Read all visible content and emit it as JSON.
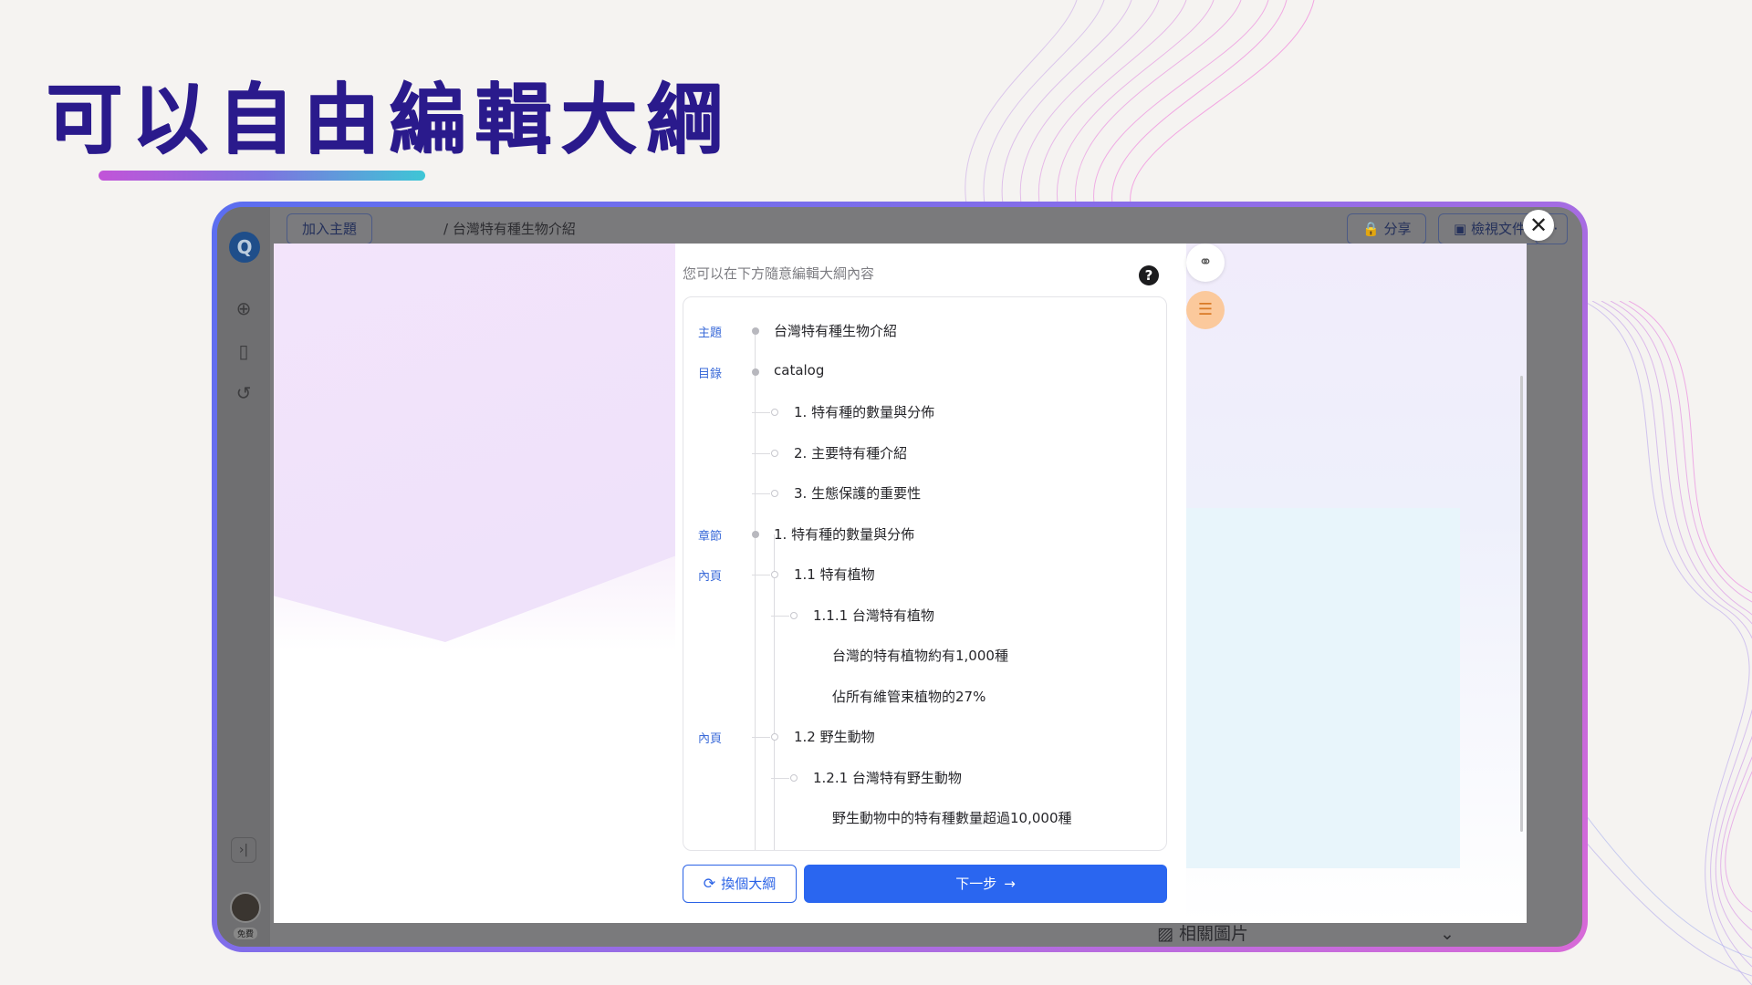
{
  "headline": "可以自由編輯大綱",
  "app": {
    "logo": "Q",
    "top_chips": {
      "add_topic": "加入主題",
      "share": "分享",
      "view_doc": "檢視文件",
      "more": "···"
    },
    "breadcrumb": "/  台灣特有種生物介紹",
    "bottom_label": "相關圖片",
    "avatar_tag": "免費",
    "sidebar_icons": [
      "new-chat-icon",
      "bookmark-icon",
      "history-icon"
    ]
  },
  "modal": {
    "hint": "您可以在下方隨意編輯大綱內容",
    "help": "?",
    "tools": [
      "template-icon",
      "outline-icon"
    ],
    "outline": [
      {
        "tag": "主題",
        "marker": "dot",
        "level": 0,
        "text": "台灣特有種生物介紹"
      },
      {
        "tag": "目錄",
        "marker": "dot",
        "level": 0,
        "text": "catalog"
      },
      {
        "tag": "",
        "marker": "ring",
        "level": 1,
        "text": "1. 特有種的數量與分佈"
      },
      {
        "tag": "",
        "marker": "ring",
        "level": 1,
        "text": "2. 主要特有種介紹"
      },
      {
        "tag": "",
        "marker": "ring",
        "level": 1,
        "text": "3. 生態保護的重要性"
      },
      {
        "tag": "章節",
        "marker": "dot",
        "level": 0,
        "text": "1. 特有種的數量與分佈"
      },
      {
        "tag": "內頁",
        "marker": "ring",
        "level": 1,
        "text": "1.1 特有植物"
      },
      {
        "tag": "",
        "marker": "ring",
        "level": 2,
        "text": "1.1.1 台灣特有植物"
      },
      {
        "tag": "",
        "marker": "none",
        "level": 3,
        "text": "台灣的特有植物約有1,000種"
      },
      {
        "tag": "",
        "marker": "none",
        "level": 3,
        "text": "佔所有維管束植物的27%"
      },
      {
        "tag": "內頁",
        "marker": "ring",
        "level": 1,
        "text": "1.2 野生動物"
      },
      {
        "tag": "",
        "marker": "ring",
        "level": 2,
        "text": "1.2.1 台灣特有野生動物"
      },
      {
        "tag": "",
        "marker": "none",
        "level": 3,
        "text": "野生動物中的特有種數量超過10,000種"
      }
    ],
    "change_button": "換個大綱",
    "next_button": "下一步"
  },
  "colors": {
    "headline": "#2a1a8c",
    "primary": "#2a66f0",
    "tag": "#3a6ad8"
  }
}
